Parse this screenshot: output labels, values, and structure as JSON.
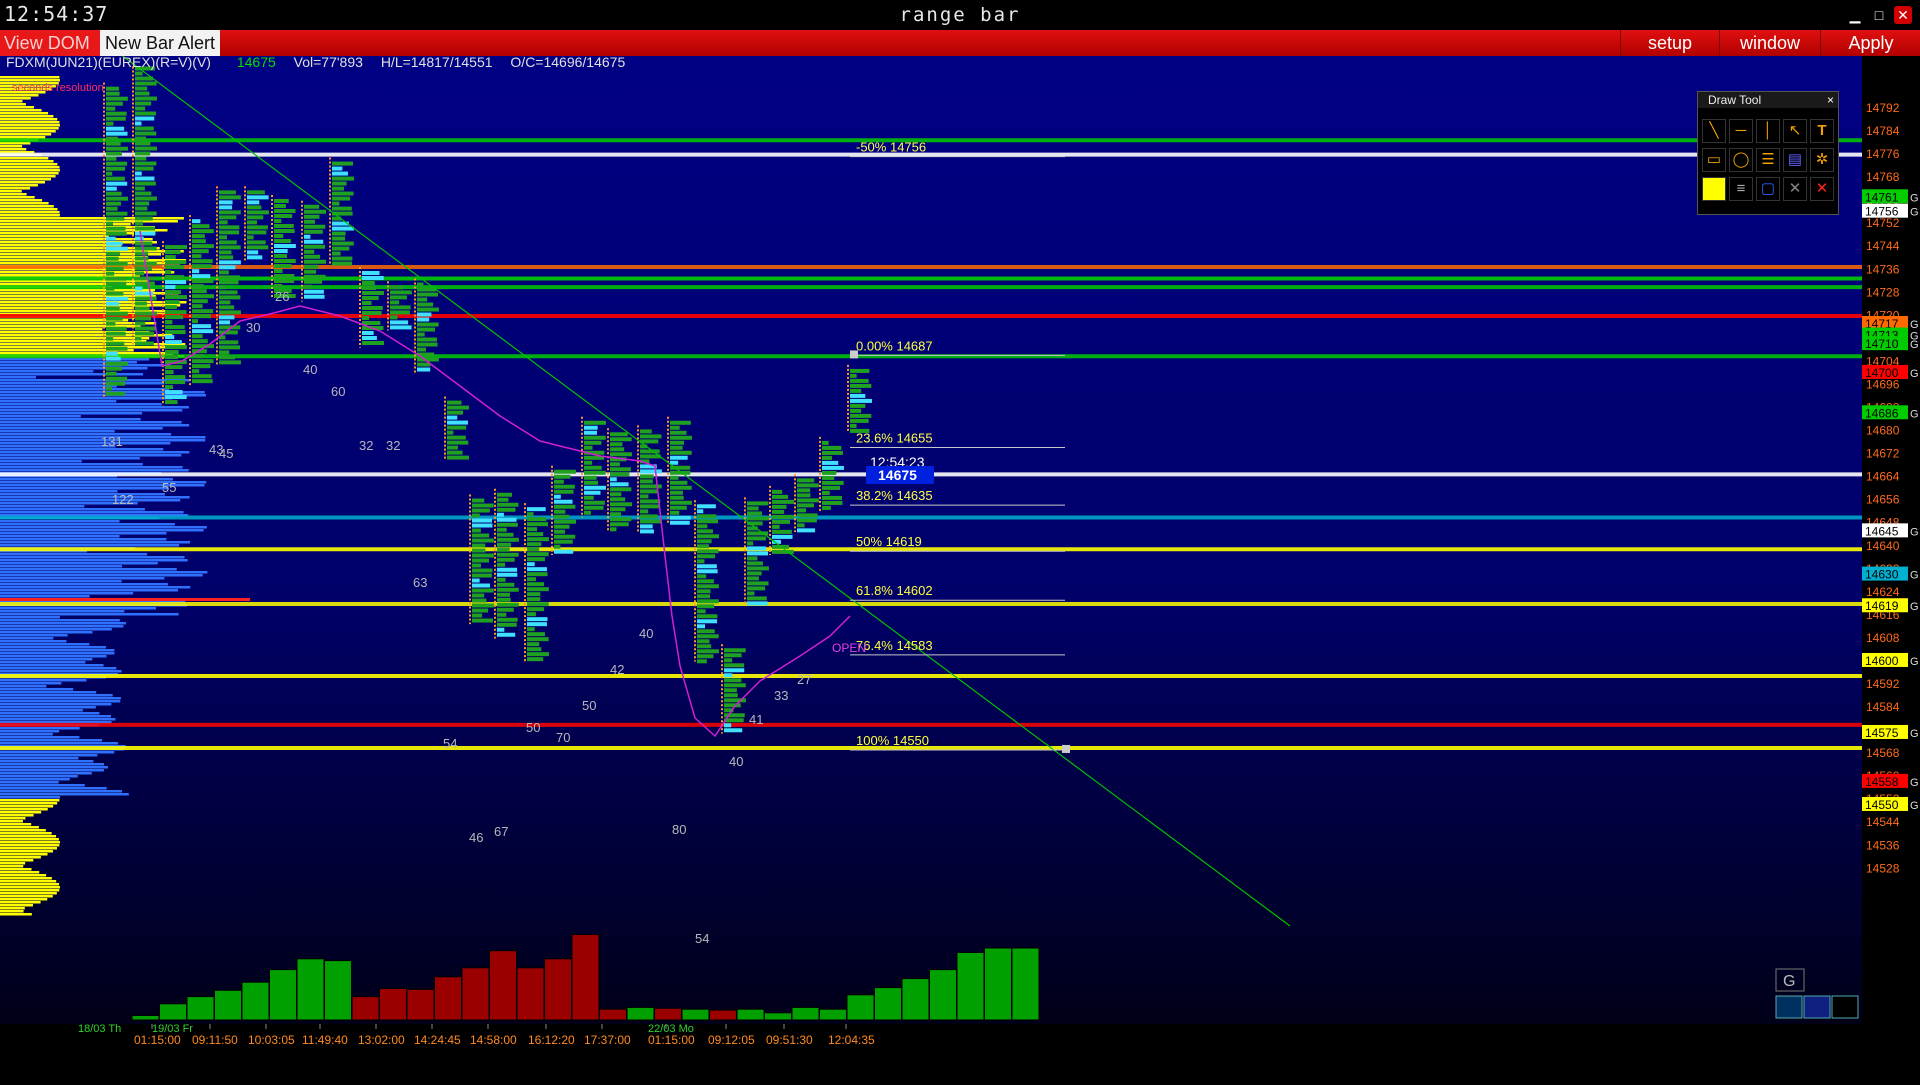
{
  "window": {
    "clock": "12:54:37",
    "title": "range bar"
  },
  "toolbar": {
    "view_dom": "View DOM",
    "new_bar_alert": "New Bar Alert",
    "setup": "setup",
    "window": "window",
    "apply": "Apply"
  },
  "instrument": {
    "symbol": "FDXM(JUN21)(EUREX)(R=V)(V)",
    "last": "14675",
    "vol": "Vol=77'893",
    "hl": "H/L=14817/14551",
    "oc": "O/C=14696/14675",
    "resolution": "seconds resolution"
  },
  "draw_tool": {
    "title": "Draw Tool",
    "close": "×",
    "tools": [
      "line-icon",
      "hline-icon",
      "vline-icon",
      "arrow-icon",
      "text-icon",
      "rect-icon",
      "ellipse-icon",
      "channel-icon",
      "fib-icon",
      "gear-icon",
      "color-swatch",
      "list-icon",
      "box-icon",
      "cross-icon",
      "delete-icon"
    ]
  },
  "price_axis": {
    "labels": [
      "14792",
      "14784",
      "14776",
      "14768",
      "14760",
      "14752",
      "14744",
      "14736",
      "14728",
      "14720",
      "14712",
      "14704",
      "14696",
      "14688",
      "14680",
      "14672",
      "14664",
      "14656",
      "14648",
      "14640",
      "14632",
      "14624",
      "14616",
      "14608",
      "14600",
      "14592",
      "14584",
      "14576",
      "14568",
      "14560",
      "14552",
      "14544",
      "14536",
      "14528"
    ]
  },
  "levels": [
    {
      "price": "14761",
      "color": "#00cc00",
      "tag": "G"
    },
    {
      "price": "14756",
      "color": "#ffffff",
      "tag": "G"
    },
    {
      "price": "14717",
      "color": "#ff6a00",
      "tag": "G"
    },
    {
      "price": "14713",
      "color": "#00cc00",
      "tag": "G"
    },
    {
      "price": "14710",
      "color": "#00cc00",
      "tag": "G"
    },
    {
      "price": "14700",
      "color": "#ff0000",
      "tag": "G"
    },
    {
      "price": "14686",
      "color": "#00cc00",
      "tag": "G"
    },
    {
      "price": "14645",
      "color": "#ffffff",
      "tag": "G"
    },
    {
      "price": "14630",
      "color": "#00b0d0",
      "tag": "G"
    },
    {
      "price": "14619",
      "color": "#ffff00",
      "tag": "G"
    },
    {
      "price": "14600",
      "color": "#ffff00",
      "tag": "G"
    },
    {
      "price": "14575",
      "color": "#ffff00",
      "tag": "G"
    },
    {
      "price": "14558",
      "color": "#ff0000",
      "tag": "G"
    },
    {
      "price": "14550",
      "color": "#ffff00",
      "tag": "G"
    }
  ],
  "fib": [
    {
      "label": "-50% 14756"
    },
    {
      "label": "0.00% 14687"
    },
    {
      "label": "23.6% 14655"
    },
    {
      "label": "38.2% 14635"
    },
    {
      "label": "50% 14619"
    },
    {
      "label": "61.8% 14602"
    },
    {
      "label": "76.4% 14583"
    },
    {
      "label": "100% 14550"
    }
  ],
  "price_tag": {
    "time": "12:54:23",
    "price": "14675"
  },
  "open_label": "OPEN",
  "bar_counts": [
    "131",
    "122",
    "55",
    "43",
    "45",
    "30",
    "26",
    "40",
    "60",
    "32",
    "32",
    "63",
    "54",
    "46",
    "67",
    "50",
    "70",
    "50",
    "42",
    "40",
    "80",
    "54",
    "40",
    "41",
    "33",
    "27"
  ],
  "time_axis": {
    "dates": [
      "18/03 Th",
      "19/03 Fr",
      "22/03 Mo"
    ],
    "times": [
      "01:15:00",
      "09:11:50",
      "10:03:05",
      "11:49:40",
      "13:02:00",
      "14:24:45",
      "14:58:00",
      "16:12:20",
      "17:37:00",
      "01:15:00",
      "09:12:05",
      "09:51:30",
      "12:04:35"
    ]
  },
  "volume_bars": [
    0.05,
    0.18,
    0.26,
    0.33,
    0.42,
    0.56,
    0.68,
    0.66,
    0.26,
    0.35,
    0.34,
    0.48,
    0.58,
    0.77,
    0.58,
    0.68,
    0.95,
    0.12,
    0.14,
    0.13,
    0.12,
    0.11,
    0.12,
    0.08,
    0.14,
    0.12,
    0.28,
    0.36,
    0.46,
    0.56,
    0.75,
    0.8,
    0.8
  ],
  "corner": {
    "g": "G"
  }
}
